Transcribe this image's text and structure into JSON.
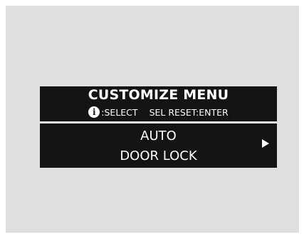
{
  "menu": {
    "title": "CUSTOMIZE MENU",
    "hints": {
      "select_icon": "info-icon",
      "select_label": ":SELECT",
      "enter_label": "SEL RESET:ENTER"
    },
    "selected_item": {
      "line1": "AUTO",
      "line2": "DOOR LOCK",
      "arrow_icon": "right-triangle-icon"
    }
  },
  "colors": {
    "background": "#dfdfe0",
    "display": "#141414",
    "text": "#ffffff"
  }
}
